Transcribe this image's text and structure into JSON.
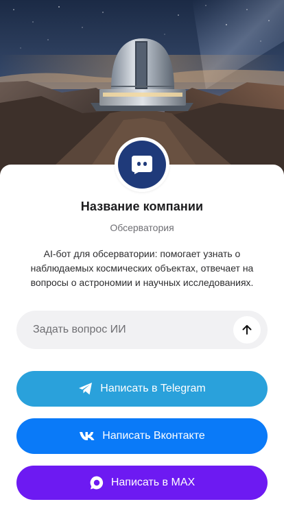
{
  "company": {
    "name": "Название компании",
    "type": "Обсерватория",
    "description": "AI-бот для обсерватории: помогает узнать о наблюдаемых космических объектах, отвечает на вопросы о астрономии и научных исследованиях."
  },
  "ask": {
    "placeholder": "Задать вопрос ИИ",
    "send_icon": "arrow-up-icon"
  },
  "buttons": {
    "telegram": {
      "label": "Написать в Telegram",
      "color": "#2aa1db",
      "icon": "telegram-icon"
    },
    "vk": {
      "label": "Написать Вконтакте",
      "color": "#0a7af8",
      "icon": "vk-icon"
    },
    "max": {
      "label": "Написать в MAX",
      "color": "#6d1af2",
      "icon": "max-icon"
    }
  },
  "avatar": {
    "color": "#1f3a7a",
    "icon": "chat-bot-icon"
  },
  "hero": {
    "icon": "observatory-illustration"
  }
}
